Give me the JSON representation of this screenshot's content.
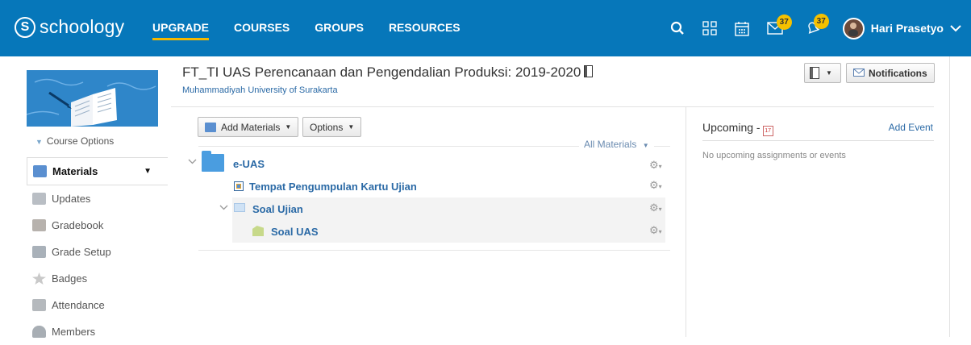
{
  "brand": {
    "name": "schoology",
    "mark": "S"
  },
  "nav": [
    {
      "label": "UPGRADE",
      "active": true
    },
    {
      "label": "COURSES"
    },
    {
      "label": "GROUPS"
    },
    {
      "label": "RESOURCES"
    }
  ],
  "header_icons": {
    "messages_count": "37",
    "notifications_count": "37"
  },
  "user": {
    "name": "Hari Prasetyo"
  },
  "sidebar": {
    "course_options": "Course Options",
    "items": [
      {
        "label": "Materials",
        "active": true,
        "icon": "materials-icon"
      },
      {
        "label": "Updates",
        "icon": "updates-icon"
      },
      {
        "label": "Gradebook",
        "icon": "gradebook-icon"
      },
      {
        "label": "Grade Setup",
        "icon": "grade-setup-icon"
      },
      {
        "label": "Badges",
        "icon": "badges-icon"
      },
      {
        "label": "Attendance",
        "icon": "attendance-icon"
      },
      {
        "label": "Members",
        "icon": "members-icon"
      }
    ]
  },
  "course": {
    "title": "FT_TI UAS Perencanaan dan Pengendalian Produksi: 2019-2020",
    "school": "Muhammadiyah University of Surakarta"
  },
  "toolbar": {
    "add_materials": "Add Materials",
    "options": "Options",
    "all_materials": "All Materials",
    "notifications": "Notifications"
  },
  "materials": [
    {
      "label": "e-UAS",
      "type": "folder"
    },
    {
      "label": "Tempat Pengumpulan Kartu Ujian",
      "type": "assignment"
    },
    {
      "label": "Soal Ujian",
      "type": "folder"
    },
    {
      "label": "Soal UAS",
      "type": "file"
    }
  ],
  "upcoming": {
    "title": "Upcoming -",
    "calendar_day": "17",
    "add_event": "Add Event",
    "empty": "No upcoming assignments or events"
  },
  "colors": {
    "topbar": "#0677ba",
    "accent": "#f5b800",
    "link": "#2b6aa6"
  }
}
